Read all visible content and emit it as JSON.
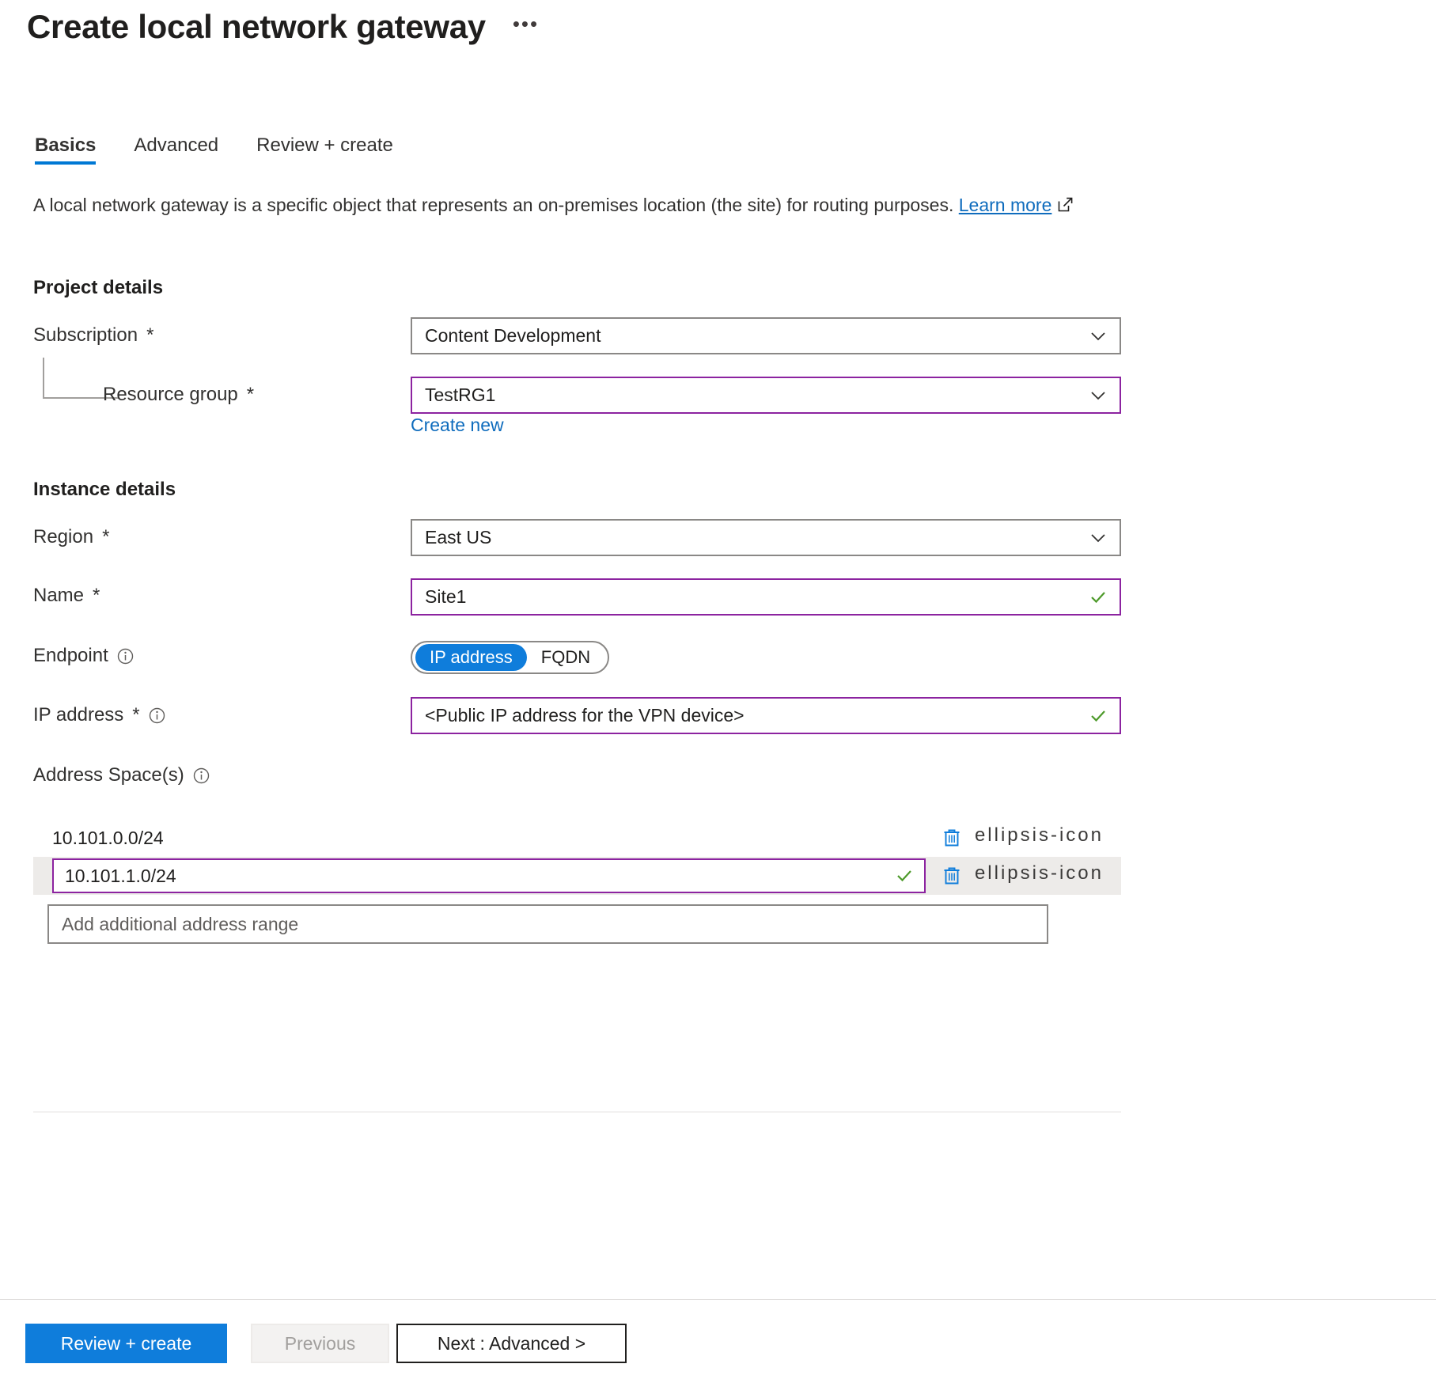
{
  "header": {
    "title": "Create local network gateway",
    "more_menu": "•••"
  },
  "tabs": [
    {
      "label": "Basics",
      "active": true
    },
    {
      "label": "Advanced",
      "active": false
    },
    {
      "label": "Review + create",
      "active": false
    }
  ],
  "intro": {
    "text": "A local network gateway is a specific object that represents an on-premises location (the site) for routing purposes. ",
    "link_text": "Learn more",
    "link_icon": "external-link-icon"
  },
  "project_details": {
    "heading": "Project details",
    "subscription": {
      "label": "Subscription",
      "required": "*",
      "value": "Content Development",
      "icon": "chevron-down-icon"
    },
    "resource_group": {
      "label": "Resource group",
      "required": "*",
      "value": "TestRG1",
      "icon": "chevron-down-icon",
      "create_new": "Create new"
    }
  },
  "instance_details": {
    "heading": "Instance details",
    "region": {
      "label": "Region",
      "required": "*",
      "value": "East US",
      "icon": "chevron-down-icon"
    },
    "name": {
      "label": "Name",
      "required": "*",
      "value": "Site1",
      "icon": "checkmark-icon"
    },
    "endpoint": {
      "label": "Endpoint",
      "info_icon": "info-icon",
      "options": [
        {
          "label": "IP address",
          "selected": true
        },
        {
          "label": "FQDN",
          "selected": false
        }
      ]
    },
    "ip_address": {
      "label": "IP address",
      "required": "*",
      "info_icon": "info-icon",
      "value": "<Public IP address for the VPN device>",
      "icon": "checkmark-icon"
    },
    "address_spaces": {
      "label": "Address Space(s)",
      "info_icon": "info-icon",
      "rows": [
        {
          "value": "10.101.0.0/24",
          "editing": false,
          "selected": false
        },
        {
          "value": "10.101.1.0/24",
          "editing": true,
          "selected": true
        }
      ],
      "add_placeholder": "Add additional address range",
      "delete_icon": "trash-icon",
      "more_icon": "ellipsis-icon"
    }
  },
  "footer": {
    "review_create": "Review + create",
    "previous": "Previous",
    "next": "Next : Advanced >"
  },
  "colors": {
    "accent_blue": "#0f7ddb",
    "link_blue": "#0f6cbd",
    "field_accent_purple": "#8c23a0",
    "valid_green": "#4d9a2a",
    "border_gray": "#8a8886"
  }
}
